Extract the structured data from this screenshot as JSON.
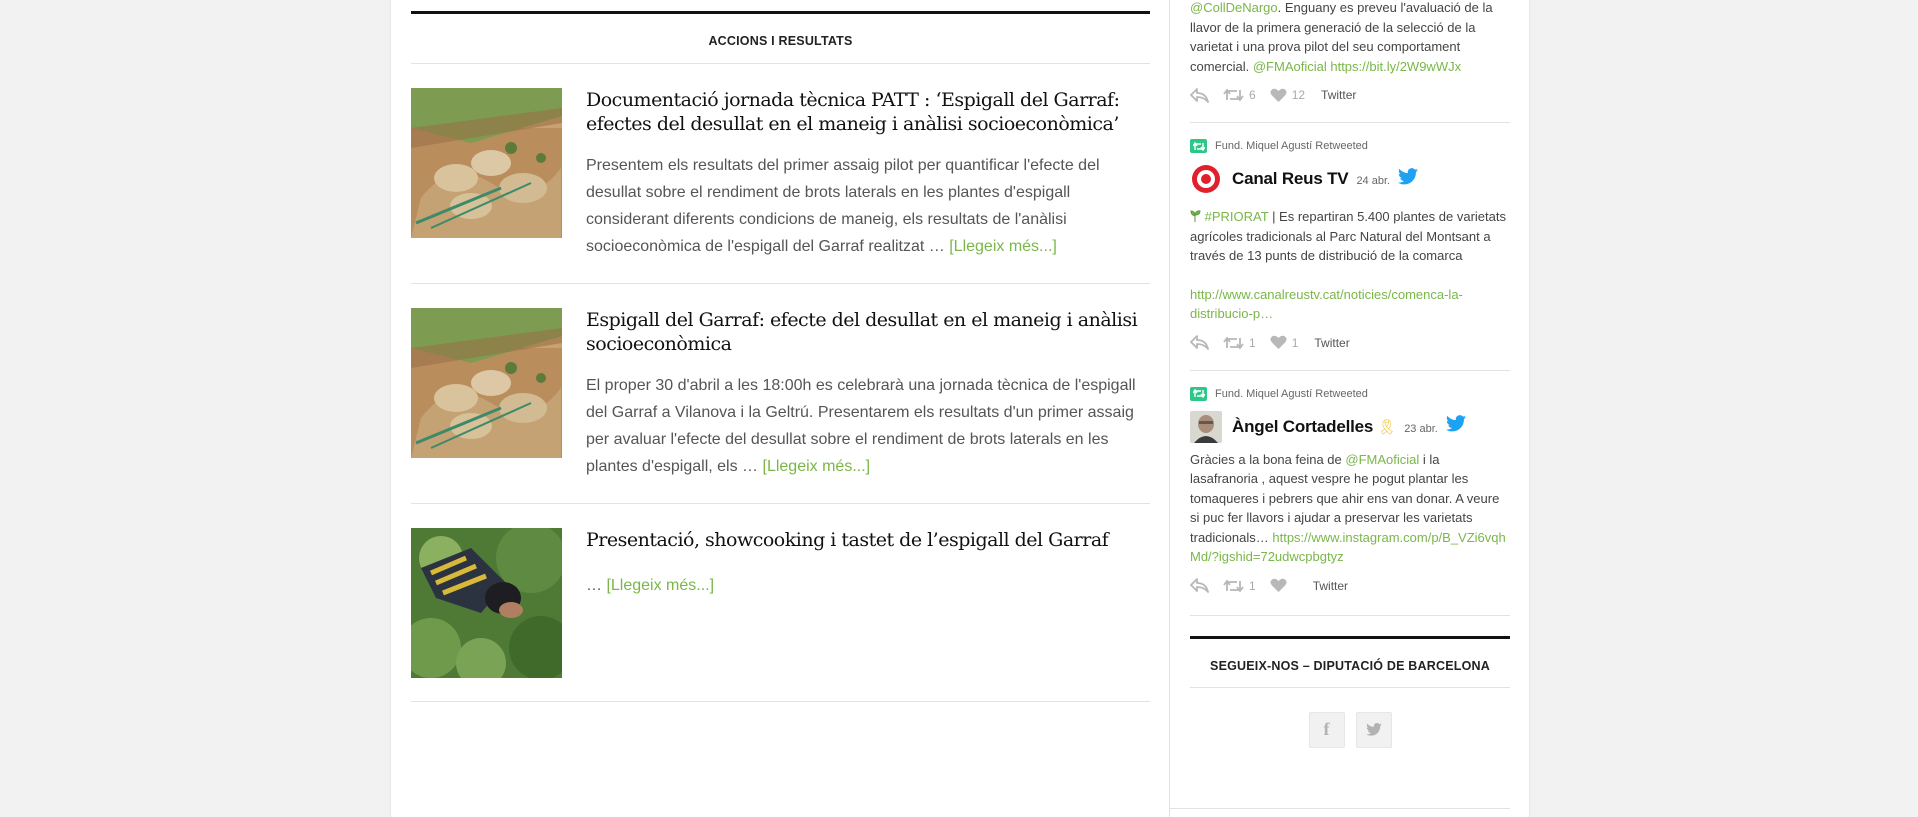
{
  "main": {
    "section_title": "ACCIONS I RESULTATS",
    "read_more": "[Llegeix més...]",
    "posts": [
      {
        "title": "Documentació jornada tècnica PATT : ‘Espigall del Garraf: efectes del desullat en el maneig i anàlisi socioeconòmica’",
        "excerpt": "Presentem els resultats del primer assaig pilot per quantificar l'efecte del desullat sobre el rendiment de brots laterals en les plantes d'espigall considerant diferents condicions de maneig, els resultats de l'anàlisi socioeconòmica de l'espigall del Garraf realitzat …",
        "thumbnail": "field-plants-photo"
      },
      {
        "title": "Espigall del Garraf: efecte del desullat en el maneig i anàlisi socioeconòmica",
        "excerpt": "El proper 30 d'abril a les 18:00h es celebrarà una jornada tècnica de l'espigall del Garraf a Vilanova i la Geltrú. Presentarem els resultats d'un primer assaig per avaluar l'efecte del desullat sobre el rendiment de brots laterals en les plantes d'espigall, els …",
        "thumbnail": "field-plants-photo"
      },
      {
        "title": "Presentació, showcooking i tastet de l’espigall del Garraf",
        "excerpt": "…",
        "thumbnail": "farmer-harvesting-photo"
      }
    ]
  },
  "sidebar": {
    "tweets": [
      {
        "text_mention": "@CollDeNargo",
        "text_body": ". Enguany es preveu l'avaluació de la llavor de la primera generació de la selecció de la varietat i una prova pilot del seu comportament comercial. ",
        "text_mention2": "@FMAoficial",
        "text_link": " https://bit.ly/2W9wWJx",
        "retweets": "6",
        "likes": "12",
        "source": "Twitter"
      },
      {
        "retweeted_by": "Fund. Miquel Agustí Retweeted",
        "author": "Canal Reus TV",
        "date": "24 abr.",
        "hashtag": "#PRIORAT",
        "text_body": " | Es repartiran 5.400 plantes de varietats agrícoles tradicionals al Parc Natural del Montsant a través de 13 punts de distribució de la comarca",
        "link": "http://www.canalreustv.cat/noticies/comenca-la-distribucio-p…",
        "retweets": "1",
        "likes": "1",
        "source": "Twitter"
      },
      {
        "retweeted_by": "Fund. Miquel Agustí Retweeted",
        "author": "Àngel Cortadelles",
        "author_emoji": "🎗",
        "date": "23 abr.",
        "text_pre": "Gràcies a la bona feina de ",
        "mention": "@FMAoficial",
        "text_body": " i la lasafranoria , aquest vespre he pogut plantar les tomaqueres i pebrers que ahir ens van donar. A veure si puc fer llavors i ajudar a preservar les varietats tradicionals… ",
        "link": "https://www.instagram.com/p/B_VZi6vqhMd/?igshid=72udwcpbgtyz",
        "retweets": "1",
        "likes": "",
        "source": "Twitter"
      }
    ],
    "follow_title": "SEGUEIX-NOS – DIPUTACIÓ DE BARCELONA",
    "social": [
      {
        "icon": "facebook-icon",
        "glyph": "f"
      },
      {
        "icon": "twitter-icon",
        "glyph": ""
      }
    ]
  },
  "colors": {
    "accent_green": "#7ab648",
    "retweet_green": "#2dc78a",
    "twitter_blue": "#1da1f2",
    "canal_reus_red": "#e0202a"
  }
}
